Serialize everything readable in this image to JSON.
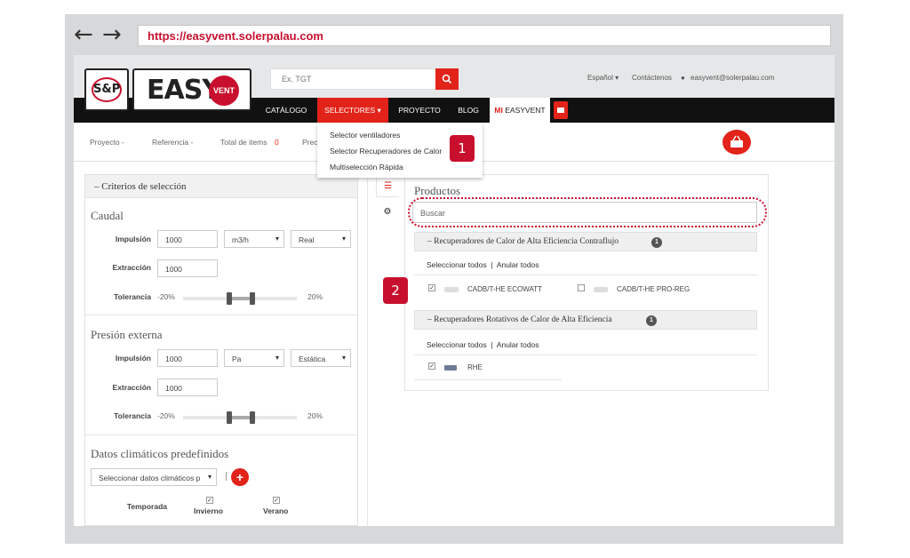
{
  "browser": {
    "back": "←",
    "forward": "→",
    "url": "https://easyvent.solerpalau.com"
  },
  "header": {
    "logo_sp": "S&P",
    "logo_easy": "EASY",
    "logo_vent": "VENT",
    "search_placeholder": "Ex. TGT",
    "language": "Español ▾",
    "contact": "Contáctenos",
    "user_email": "easyvent@solerpalau.com"
  },
  "nav": {
    "items": [
      "CATÁLOGO",
      "SELECTORES ▾",
      "PROYECTO",
      "BLOG"
    ],
    "my_prefix": "MI",
    "my_label": "EASYVENT"
  },
  "dropdown": {
    "items": [
      "Selector ventiladores",
      "Selector Recuperadores de Calor",
      "Multiselección Rápida"
    ]
  },
  "callouts": [
    "1",
    "2"
  ],
  "subbar": {
    "items": [
      "Proyecto  -",
      "Referencia  -",
      "Total de items",
      "Preci"
    ],
    "total_items": "0"
  },
  "criteria": {
    "title": "Criterios de selección",
    "caudal": {
      "title": "Caudal",
      "impulsion_label": "Impulsión",
      "impulsion_value": "1000",
      "unit": "m3/h",
      "mode": "Real",
      "extraccion_label": "Extracción",
      "extraccion_value": "1000",
      "tolerancia_label": "Tolerancia",
      "tol_min": "-20%",
      "tol_max": "20%"
    },
    "presion": {
      "title": "Presión externa",
      "impulsion_label": "Impulsión",
      "impulsion_value": "1000",
      "unit": "Pa",
      "mode": "Estática",
      "extraccion_label": "Extracción",
      "extraccion_value": "1000",
      "tolerancia_label": "Tolerancia",
      "tol_min": "-20%",
      "tol_max": "20%"
    },
    "clima": {
      "title": "Datos climáticos predefinidos",
      "select_placeholder": "Seleccionar datos climáticos p",
      "temporada_label": "Temporada",
      "invierno": "Invierno",
      "verano": "Verano"
    }
  },
  "products": {
    "title": "Productos",
    "search_placeholder": "Buscar",
    "groups": [
      {
        "title": "Recuperadores de Calor de Alta Eficiencia Contraflujo",
        "count": "1",
        "select_all": "Seleccionar todos",
        "separator": "|",
        "clear_all": "Anular todos",
        "items": [
          {
            "name": "CADB/T-HE ECOWATT",
            "checked": true
          },
          {
            "name": "CADB/T-HE PRO-REG",
            "checked": false
          }
        ]
      },
      {
        "title": "Recuperadores Rotativos de Calor de Alta Eficiencia",
        "count": "1",
        "select_all": "Seleccionar todos",
        "separator": "|",
        "clear_all": "Anular todos",
        "items": [
          {
            "name": "RHE",
            "checked": true
          }
        ]
      }
    ]
  },
  "colors": {
    "brand_red": "#e2231a",
    "callout_red": "#c8102e",
    "nav_dark": "#111111"
  }
}
